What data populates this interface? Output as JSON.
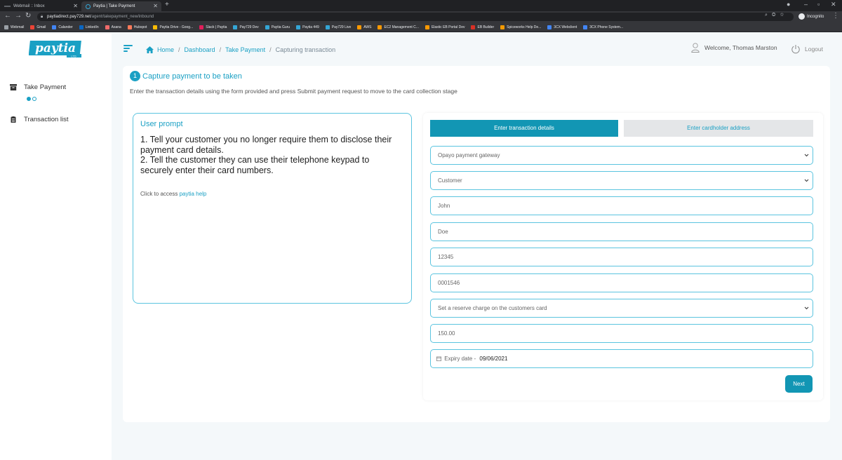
{
  "browser": {
    "tabs": [
      {
        "title": "Webmail :: Inbox",
        "active": false
      },
      {
        "title": "Paytia | Take Payment",
        "active": true
      }
    ],
    "url_domain": "paytiadirect.pay729.net",
    "url_path": "/agent/takepayment_new/inbound",
    "incognito_label": "Incognito",
    "bookmarks": [
      {
        "label": "Webmail",
        "color": "#9aa0a6"
      },
      {
        "label": "Gmail",
        "color": "#ea4335"
      },
      {
        "label": "Calander",
        "color": "#4285f4"
      },
      {
        "label": "LinkedIn",
        "color": "#0a66c2"
      },
      {
        "label": "Asana",
        "color": "#f06a6a"
      },
      {
        "label": "Hubspot",
        "color": "#ff7a59"
      },
      {
        "label": "Paytia Drive - Goog...",
        "color": "#fbbc04"
      },
      {
        "label": "Slack | Paytia",
        "color": "#e01e5a"
      },
      {
        "label": "Pay729 Dev",
        "color": "#34a6d6"
      },
      {
        "label": "Paytia Guru",
        "color": "#34a6d6"
      },
      {
        "label": "Paytia 449",
        "color": "#34a6d6"
      },
      {
        "label": "Pay729 Live",
        "color": "#34a6d6"
      },
      {
        "label": "AWS",
        "color": "#ff9900"
      },
      {
        "label": "EC2 Management C...",
        "color": "#ff9900"
      },
      {
        "label": "Elastic EB Portal Dev",
        "color": "#ff9900"
      },
      {
        "label": "EB Builder",
        "color": "#d93025"
      },
      {
        "label": "Spiceworks Help De...",
        "color": "#f29900"
      },
      {
        "label": "3CX Webclient",
        "color": "#4285f4"
      },
      {
        "label": "3CX Phone System...",
        "color": "#4285f4"
      }
    ]
  },
  "brand": {
    "accent": "#1aa0c4",
    "primary_button": "#1296b4"
  },
  "sidebar": {
    "items": [
      {
        "label": "Take Payment",
        "icon": "inbox-icon"
      },
      {
        "label": "Transaction list",
        "icon": "clipboard-icon"
      }
    ]
  },
  "header": {
    "breadcrumb": [
      "Home",
      "Dashboard",
      "Take Payment",
      "Capturing transaction"
    ],
    "welcome": "Welcome, Thomas Marston",
    "logout": "Logout"
  },
  "main": {
    "step_number": "1",
    "step_title": "Capture payment to be taken",
    "instructions": "Enter the transaction details using the form provided and press Submit payment request to move to the card collection stage",
    "prompt": {
      "title": "User prompt",
      "line1": "1. Tell your customer you no longer require them to disclose their payment card details.",
      "line2": "2. Tell the customer they can use their telephone keypad to securely enter their card numbers.",
      "help_prefix": "Click to access",
      "help_link": "paytia help"
    },
    "form": {
      "tab_active": "Enter transaction details",
      "tab_inactive": "Enter cardholder address",
      "gateway": "Opayo payment gateway",
      "customer_type": "Customer",
      "first_name": "John",
      "last_name": "Doe",
      "reference": "12345",
      "account": "0001546",
      "charge_type": "Set a reserve charge on the customers card",
      "amount": "150.00",
      "expiry_label": "Expiry date -",
      "expiry_value": "09/06/2021",
      "next": "Next"
    }
  }
}
